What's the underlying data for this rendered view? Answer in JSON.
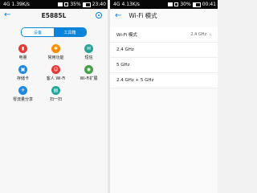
{
  "left": {
    "status": {
      "network": "4G",
      "speed": "1.39K/s",
      "battery": "35%",
      "time": "23:40"
    },
    "title": "E5885L",
    "back_icon": "back-arrow-icon",
    "settings_icon": "gear-icon",
    "tabs": [
      {
        "label": "设备",
        "active": false
      },
      {
        "label": "工具箱",
        "active": true
      }
    ],
    "tools": [
      {
        "label": "电量",
        "icon": "battery-icon",
        "color": "#e53935",
        "glyph": "▮"
      },
      {
        "label": "常用功能",
        "icon": "gear-icon",
        "color": "#fb8c00",
        "glyph": "✱"
      },
      {
        "label": "短信",
        "icon": "message-icon",
        "color": "#26a69a",
        "glyph": "✉"
      },
      {
        "label": "存储卡",
        "icon": "sd-card-icon",
        "color": "#1e88e5",
        "glyph": "▣"
      },
      {
        "label": "客人 Wi-Fi",
        "icon": "guest-user-icon",
        "color": "#e53935",
        "glyph": "☺"
      },
      {
        "label": "Wi-Fi扩展",
        "icon": "wifi-extend-icon",
        "color": "#43a047",
        "glyph": "◉"
      },
      {
        "label": "零流量分享",
        "icon": "share-icon",
        "color": "#1e88e5",
        "glyph": "✈"
      },
      {
        "label": "扫一扫",
        "icon": "scan-icon",
        "color": "#26a69a",
        "glyph": "▤"
      }
    ]
  },
  "right": {
    "status": {
      "network": "4G",
      "speed": "4.13K/s",
      "battery": "30%",
      "time": "00:41"
    },
    "title": "Wi-Fi 模式",
    "back_icon": "back-arrow-icon",
    "current": {
      "label": "Wi-Fi 模式",
      "value": "2.4 GHz",
      "chevron_icon": "chevron-right-icon"
    },
    "options": [
      {
        "label": "2.4 GHz"
      },
      {
        "label": "5 GHz"
      },
      {
        "label": "2.4 GHz + 5 GHz"
      }
    ]
  }
}
